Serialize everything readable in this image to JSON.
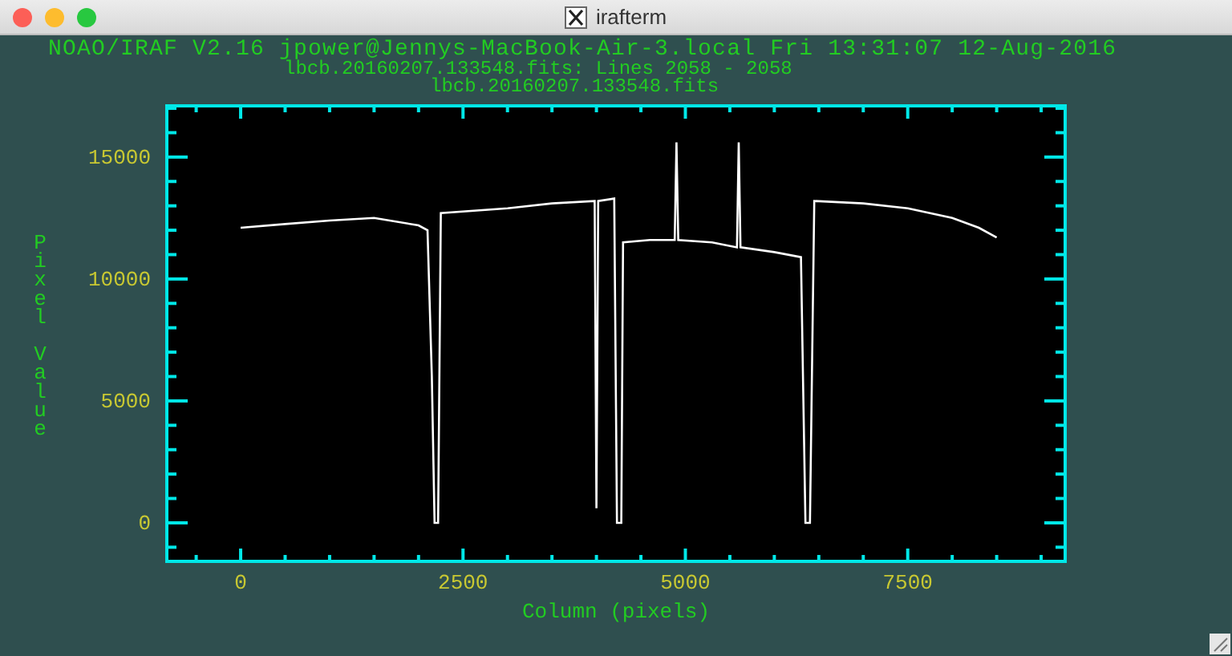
{
  "window": {
    "title": "irafterm"
  },
  "header_lines": [
    "NOAO/IRAF V2.16 jpower@Jennys-MacBook-Air-3.local Fri 13:31:07 12-Aug-2016",
    "lbcb.20160207.133548.fits: Lines 2058 - 2058",
    "lbcb.20160207.133548.fits"
  ],
  "chart_data": {
    "type": "line",
    "xlabel": "Column (pixels)",
    "ylabel": "Pixel Value",
    "xlim": [
      -830,
      9270
    ],
    "ylim": [
      -1580,
      17100
    ],
    "xticks": [
      0,
      2500,
      5000,
      7500
    ],
    "yticks": [
      0,
      5000,
      10000,
      15000
    ],
    "x": [
      0,
      500,
      1000,
      1500,
      2000,
      2100,
      2150,
      2180,
      2220,
      2250,
      3000,
      3500,
      3980,
      4000,
      4020,
      4200,
      4230,
      4280,
      4300,
      4600,
      4880,
      4900,
      4920,
      5300,
      5580,
      5600,
      5620,
      6000,
      6300,
      6350,
      6400,
      6450,
      7000,
      7500,
      8000,
      8300,
      8500
    ],
    "series": [
      {
        "color": "#ffffff",
        "values": [
          12100,
          12250,
          12400,
          12500,
          12200,
          12000,
          6000,
          0,
          0,
          12700,
          12900,
          13100,
          13200,
          600,
          13200,
          13300,
          0,
          0,
          11500,
          11600,
          11600,
          15600,
          11600,
          11500,
          11300,
          15600,
          11300,
          11100,
          10900,
          0,
          0,
          13200,
          13100,
          12900,
          12500,
          12100,
          11700
        ]
      }
    ]
  }
}
